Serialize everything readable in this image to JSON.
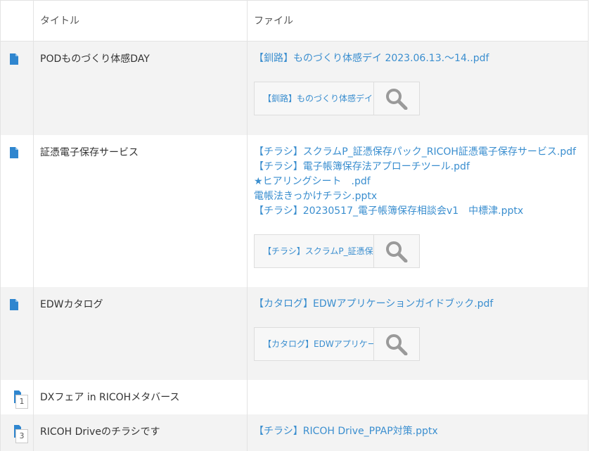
{
  "table": {
    "header": {
      "title_label": "タイトル",
      "file_label": "ファイル"
    },
    "rows": [
      {
        "title": "PODものづくり体感DAY",
        "files": [
          "【釧路】ものづくり体感デイ 2023.06.13.～14..pdf"
        ],
        "preview_label": "【釧路】ものづくり体感デイ"
      },
      {
        "title": "証憑電子保存サービス",
        "files": [
          "【チラシ】スクラムP_証憑保存パック_RICOH証憑電子保存サービス.pdf",
          "【チラシ】電子帳簿保存法アプローチツール.pdf",
          "★ヒアリングシート　.pdf",
          "電帳法きっかけチラシ.pptx",
          "【チラシ】20230517_電子帳簿保存相談会v1　中標津.pptx"
        ],
        "preview_label": "【チラシ】スクラムP_証憑保存パック"
      },
      {
        "title": "EDWカタログ",
        "files": [
          "【カタログ】EDWアプリケーションガイドブック.pdf"
        ],
        "preview_label": "【カタログ】EDWアプリケーションガイドブック"
      },
      {
        "title": "DXフェア in RICOHメタバース",
        "badge": "1",
        "files": []
      },
      {
        "title": "RICOH Driveのチラシです",
        "badge": "3",
        "files": [
          "【チラシ】RICOH Drive_PPAP対策.pptx"
        ]
      }
    ]
  },
  "colors": {
    "link": "#3a8ecf",
    "doc_icon": "#2f86cf",
    "row_shade": "#f3f3f3",
    "border": "#e3e3e3"
  },
  "icons": {
    "document": "document-icon",
    "zoom": "magnifier-icon",
    "comment_badge": "comment-count-icon"
  }
}
